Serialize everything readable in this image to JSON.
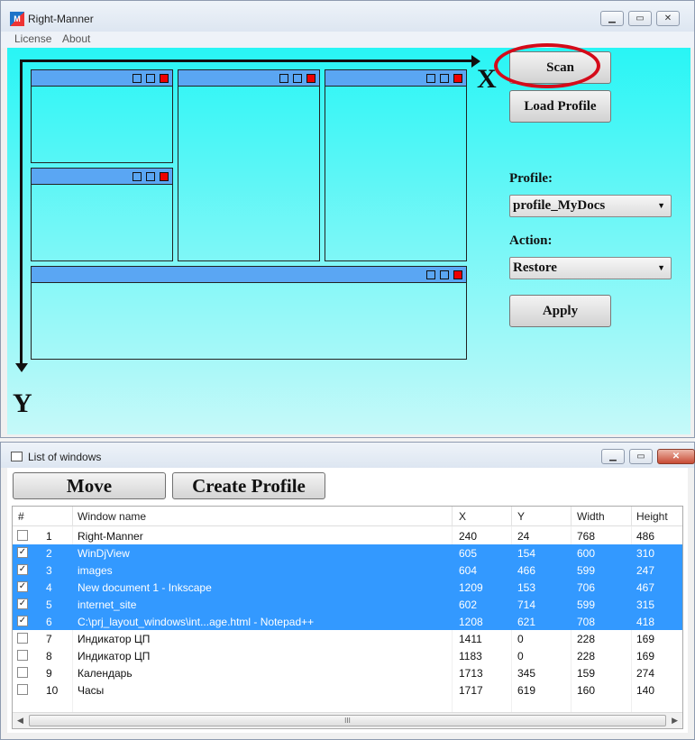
{
  "main_window": {
    "title": "Right-Manner",
    "icon_label": "M",
    "menu": [
      "License",
      "About"
    ],
    "axis": {
      "x_label": "X",
      "y_label": "Y"
    },
    "scan_label": "Scan",
    "load_profile_label": "Load Profile",
    "profile_label": "Profile:",
    "profile_value": "profile_MyDocs",
    "action_label": "Action:",
    "action_value": "Restore",
    "apply_label": "Apply",
    "accent_color": "#5aa6f3",
    "highlight_color": "#d40b1a"
  },
  "list_window": {
    "title": "List of windows",
    "move_label": "Move",
    "create_profile_label": "Create Profile",
    "columns": [
      "#",
      "Window name",
      "X",
      "Y",
      "Width",
      "Height"
    ],
    "rows": [
      {
        "checked": false,
        "n": "1",
        "name": "Right-Manner",
        "x": "240",
        "y": "24",
        "w": "768",
        "h": "486"
      },
      {
        "checked": true,
        "n": "2",
        "name": "WinDjView",
        "x": "605",
        "y": "154",
        "w": "600",
        "h": "310"
      },
      {
        "checked": true,
        "n": "3",
        "name": "images",
        "x": "604",
        "y": "466",
        "w": "599",
        "h": "247"
      },
      {
        "checked": true,
        "n": "4",
        "name": "New document 1 - Inkscape",
        "x": "1209",
        "y": "153",
        "w": "706",
        "h": "467"
      },
      {
        "checked": true,
        "n": "5",
        "name": "internet_site",
        "x": "602",
        "y": "714",
        "w": "599",
        "h": "315"
      },
      {
        "checked": true,
        "n": "6",
        "name": "C:\\prj_layout_windows\\int...age.html - Notepad++",
        "x": "1208",
        "y": "621",
        "w": "708",
        "h": "418"
      },
      {
        "checked": false,
        "n": "7",
        "name": "Индикатор ЦП",
        "x": "1411",
        "y": "0",
        "w": "228",
        "h": "169"
      },
      {
        "checked": false,
        "n": "8",
        "name": "Индикатор ЦП",
        "x": "1183",
        "y": "0",
        "w": "228",
        "h": "169"
      },
      {
        "checked": false,
        "n": "9",
        "name": "Календарь",
        "x": "1713",
        "y": "345",
        "w": "159",
        "h": "274"
      },
      {
        "checked": false,
        "n": "10",
        "name": "Часы",
        "x": "1717",
        "y": "619",
        "w": "160",
        "h": "140"
      }
    ],
    "selection_color": "#3399ff"
  }
}
